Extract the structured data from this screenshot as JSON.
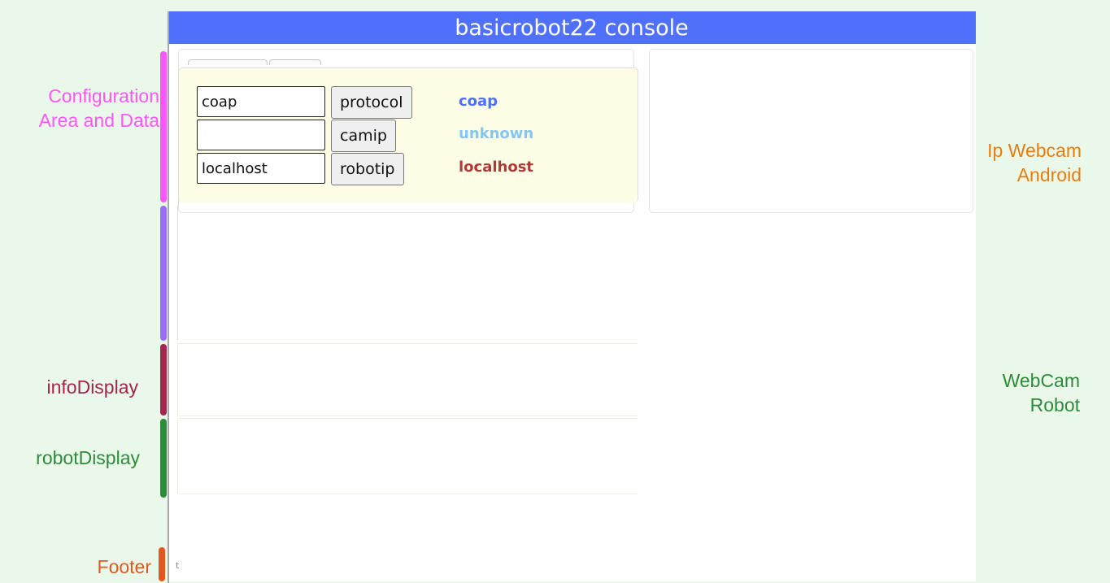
{
  "title": "basicrobot22 console",
  "annotations": {
    "configuration": "Configuration\nArea and Data",
    "ip_webcam": "Ip Webcam\nAndroid",
    "info_display": "infoDisplay",
    "robot_display": "robotDisplay",
    "webcam_robot": "WebCam\nRobot",
    "footer": "Footer"
  },
  "config": {
    "protocol": {
      "input_value": "coap",
      "button_label": "protocol",
      "current_value": "coap",
      "value_color": "#4e70fb"
    },
    "camip": {
      "input_value": "",
      "button_label": "camip",
      "current_value": "unknown",
      "value_color": "#86c5f0"
    },
    "robotip": {
      "input_value": "localhost",
      "button_label": "robotip",
      "current_value": "localhost",
      "value_color": "#b03a3a"
    }
  },
  "footer_text": "t",
  "colors": {
    "title_bar": "#4e70fb",
    "configuration": "#ff55ff",
    "area_bar": "#9a6cff",
    "info_display": "#a3264f",
    "robot_display": "#2e8b3a",
    "ip_webcam": "#e87d0d",
    "webcam_robot": "#2e8b3a",
    "footer": "#e05a1e"
  }
}
